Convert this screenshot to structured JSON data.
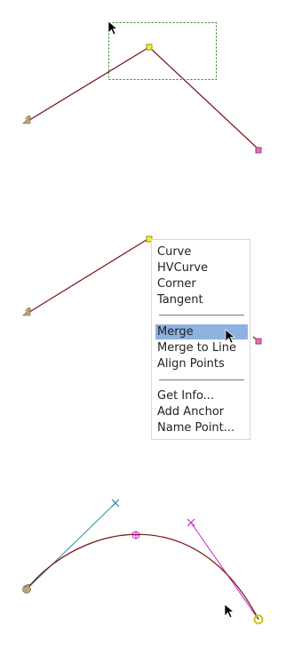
{
  "context_menu": {
    "items": [
      {
        "label": "Curve",
        "selected": false
      },
      {
        "label": "HVCurve",
        "selected": false
      },
      {
        "label": "Corner",
        "selected": false
      },
      {
        "label": "Tangent",
        "selected": false
      },
      {
        "label": "Merge",
        "selected": true
      },
      {
        "label": "Merge to Line",
        "selected": false
      },
      {
        "label": "Align Points",
        "selected": false
      },
      {
        "label": "Get Info...",
        "selected": false
      },
      {
        "label": "Add Anchor",
        "selected": false
      },
      {
        "label": "Name Point...",
        "selected": false
      }
    ],
    "selected_color": "#8db2e0"
  },
  "colors": {
    "path_stroke": "#7a1c1c",
    "start_point": "#b8a878",
    "end_point": "#e070b0",
    "selected_point": "#c8c800",
    "selection_box": "#2a7a2a",
    "control_handle_left": "#2a8aa8",
    "control_handle_right": "#d020d0",
    "midpoint_marker": "#c020c0"
  },
  "icons": {
    "start_point": "curved-arrow-start-icon",
    "cursor": "arrow-cursor-icon",
    "end_point": "square-point-icon",
    "anchor": "circle-point-icon"
  }
}
